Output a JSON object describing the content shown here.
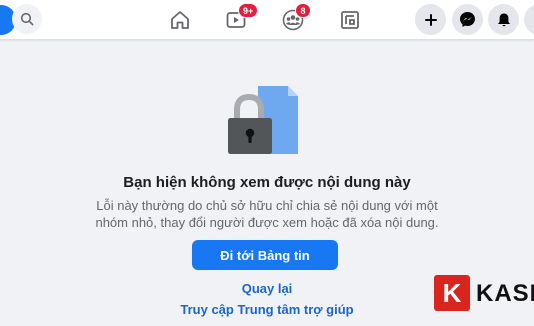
{
  "colors": {
    "brand_blue": "#1877f2",
    "badge_red": "#e41e3f",
    "link_blue": "#1a66c9",
    "page_bg": "#f0f2f5"
  },
  "topbar": {
    "icons": [
      "facebook-logo",
      "search-icon",
      "home-icon",
      "watch-icon",
      "groups-icon",
      "gaming-icon",
      "plus-icon",
      "messenger-icon",
      "notifications-icon"
    ],
    "watch_badge": "9+",
    "groups_badge": "8"
  },
  "content": {
    "title": "Bạn hiện không xem được nội dung này",
    "description": "Lỗi này thường do chủ sở hữu chỉ chia sẻ nội dung với một nhóm nhỏ, thay đổi người được xem hoặc đã xóa nội dung.",
    "primary_button": "Đi tới Bảng tin",
    "back_link": "Quay lại",
    "help_link": "Truy cập Trung tâm trợ giúp"
  },
  "watermark": {
    "letter": "K",
    "text": "KASI"
  }
}
